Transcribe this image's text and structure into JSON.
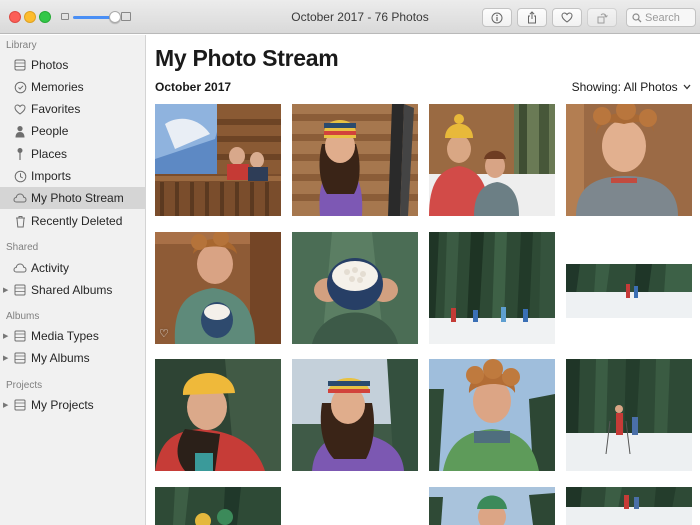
{
  "window": {
    "title": "October 2017 - 76 Photos"
  },
  "toolbar": {
    "info_icon": "info-icon",
    "share_icon": "share-icon",
    "favorite_icon": "heart-icon",
    "rotate_icon": "rotate-icon",
    "search_placeholder": "Search",
    "zoom_level": 0.8
  },
  "sidebar": {
    "sections": {
      "library": "Library",
      "shared": "Shared",
      "albums": "Albums",
      "projects": "Projects"
    },
    "library_items": [
      {
        "label": "Photos",
        "icon": "photos-icon"
      },
      {
        "label": "Memories",
        "icon": "memories-icon"
      },
      {
        "label": "Favorites",
        "icon": "heart-icon"
      },
      {
        "label": "People",
        "icon": "person-icon"
      },
      {
        "label": "Places",
        "icon": "pin-icon"
      },
      {
        "label": "Imports",
        "icon": "clock-icon"
      },
      {
        "label": "My Photo Stream",
        "icon": "cloud-icon"
      },
      {
        "label": "Recently Deleted",
        "icon": "trash-icon"
      }
    ],
    "shared_items": [
      {
        "label": "Activity",
        "icon": "cloud-icon"
      },
      {
        "label": "Shared Albums",
        "icon": "folder-icon"
      }
    ],
    "album_items": [
      {
        "label": "Media Types",
        "icon": "folder-icon"
      },
      {
        "label": "My Albums",
        "icon": "folder-icon"
      }
    ],
    "project_items": [
      {
        "label": "My Projects",
        "icon": "folder-icon"
      }
    ],
    "selected": "My Photo Stream"
  },
  "main": {
    "title": "My Photo Stream",
    "section": "October 2017",
    "showing_label": "Showing: All Photos"
  },
  "colors": {
    "accent": "#4a8ff5",
    "sidebar_bg": "#f1f1f1",
    "selection": "#d5d5d5"
  }
}
